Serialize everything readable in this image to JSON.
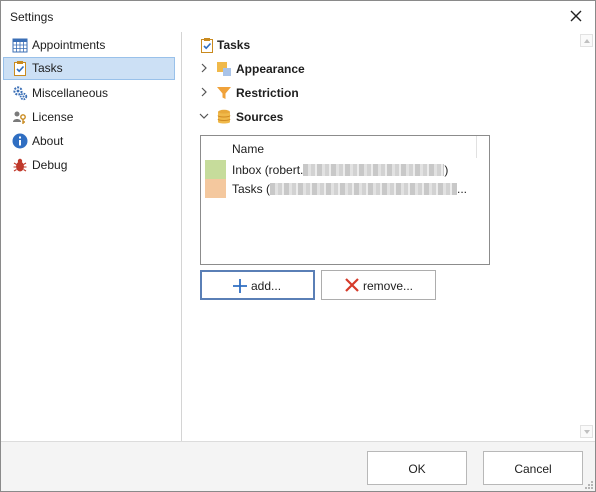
{
  "window": {
    "title": "Settings"
  },
  "sidebar": {
    "items": [
      {
        "label": "Appointments",
        "icon": "calendar-icon"
      },
      {
        "label": "Tasks",
        "icon": "clipboard-check-icon",
        "selected": true
      },
      {
        "label": "Miscellaneous",
        "icon": "gears-icon"
      },
      {
        "label": "License",
        "icon": "people-key-icon"
      },
      {
        "label": "About",
        "icon": "info-icon"
      },
      {
        "label": "Debug",
        "icon": "bug-icon"
      }
    ]
  },
  "main": {
    "heading": "Tasks",
    "sections": [
      {
        "label": "Appearance",
        "expanded": false,
        "icon": "palette-icon"
      },
      {
        "label": "Restriction",
        "expanded": false,
        "icon": "filter-icon"
      },
      {
        "label": "Sources",
        "expanded": true,
        "icon": "database-icon"
      }
    ],
    "sources_table": {
      "column_header": "Name",
      "rows": [
        {
          "prefix": "Inbox (robert.",
          "suffix": ")",
          "color": "#c6dc9b"
        },
        {
          "prefix": "Tasks (",
          "suffix": "...",
          "color": "#f4c89e"
        }
      ]
    },
    "add_button": "add...",
    "remove_button": "remove..."
  },
  "footer": {
    "ok_button": "OK",
    "cancel_button": "Cancel"
  },
  "colors": {
    "selection_bg": "#cce0f5",
    "accent_blue": "#2f6ec2",
    "remove_red": "#d63a2a"
  }
}
